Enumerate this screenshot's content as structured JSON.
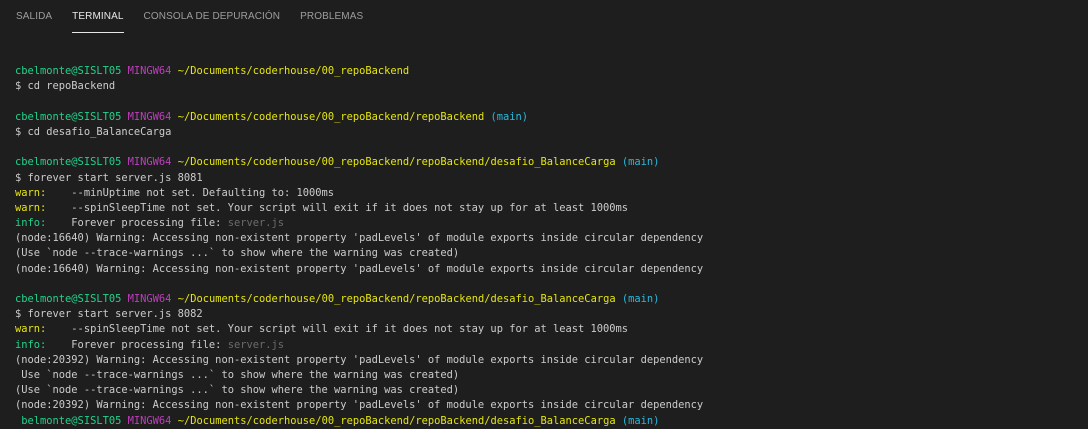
{
  "tabs": [
    {
      "label": "SALIDA"
    },
    {
      "label": "TERMINAL"
    },
    {
      "label": "CONSOLA DE DEPURACIÓN"
    },
    {
      "label": "PROBLEMAS"
    }
  ],
  "colors": {
    "background": "#1e1e1e",
    "text": "#cccccc",
    "user_host": "#23d18b",
    "mingw": "#bc3fbc",
    "path": "#e5e510",
    "branch": "#29b8db",
    "warn": "#e5e510",
    "info": "#23d18b",
    "dim": "#6b6b6b"
  },
  "terminal": {
    "lines": [
      {
        "type": "blank"
      },
      {
        "type": "prompt",
        "user": "cbelmonte@SISLT05",
        "env": "MINGW64",
        "path": "~/Documents/coderhouse/00_repoBackend",
        "branch": ""
      },
      {
        "type": "text",
        "text": "$ cd repoBackend"
      },
      {
        "type": "blank"
      },
      {
        "type": "prompt",
        "user": "cbelmonte@SISLT05",
        "env": "MINGW64",
        "path": "~/Documents/coderhouse/00_repoBackend/repoBackend",
        "branch": "(main)"
      },
      {
        "type": "text",
        "text": "$ cd desafio_BalanceCarga"
      },
      {
        "type": "blank"
      },
      {
        "type": "prompt",
        "user": "cbelmonte@SISLT05",
        "env": "MINGW64",
        "path": "~/Documents/coderhouse/00_repoBackend/repoBackend/desafio_BalanceCarga",
        "branch": "(main)"
      },
      {
        "type": "text",
        "text": "$ forever start server.js 8081"
      },
      {
        "type": "warn",
        "label": "warn:",
        "text": "    --minUptime not set. Defaulting to: 1000ms"
      },
      {
        "type": "warn",
        "label": "warn:",
        "text": "    --spinSleepTime not set. Your script will exit if it does not stay up for at least 1000ms"
      },
      {
        "type": "info",
        "label": "info:",
        "text": "    Forever processing file: ",
        "dim": "server.js"
      },
      {
        "type": "text",
        "text": "(node:16640) Warning: Accessing non-existent property 'padLevels' of module exports inside circular dependency"
      },
      {
        "type": "text",
        "text": "(Use `node --trace-warnings ...` to show where the warning was created)"
      },
      {
        "type": "text",
        "text": "(node:16640) Warning: Accessing non-existent property 'padLevels' of module exports inside circular dependency"
      },
      {
        "type": "blank"
      },
      {
        "type": "prompt",
        "user": "cbelmonte@SISLT05",
        "env": "MINGW64",
        "path": "~/Documents/coderhouse/00_repoBackend/repoBackend/desafio_BalanceCarga",
        "branch": "(main)"
      },
      {
        "type": "text",
        "text": "$ forever start server.js 8082"
      },
      {
        "type": "warn",
        "label": "warn:",
        "text": "    --spinSleepTime not set. Your script will exit if it does not stay up for at least 1000ms"
      },
      {
        "type": "info",
        "label": "info:",
        "text": "    Forever processing file: ",
        "dim": "server.js"
      },
      {
        "type": "text",
        "text": "(node:20392) Warning: Accessing non-existent property 'padLevels' of module exports inside circular dependency"
      },
      {
        "type": "text",
        "text": " Use `node --trace-warnings ...` to show where the warning was created)"
      },
      {
        "type": "text",
        "text": "(Use `node --trace-warnings ...` to show where the warning was created)"
      },
      {
        "type": "text",
        "text": "(node:20392) Warning: Accessing non-existent property 'padLevels' of module exports inside circular dependency"
      },
      {
        "type": "prompt",
        "user": " belmonte@SISLT05",
        "env": "MINGW64",
        "path": "~/Documents/coderhouse/00_repoBackend/repoBackend/desafio_BalanceCarga",
        "branch": "(main)"
      }
    ]
  }
}
